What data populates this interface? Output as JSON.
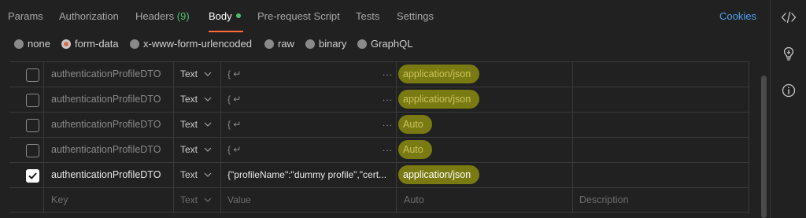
{
  "tabs": [
    {
      "label": "Params"
    },
    {
      "label": "Authorization"
    },
    {
      "label": "Headers",
      "count": "(9)"
    },
    {
      "label": "Body",
      "active": true
    },
    {
      "label": "Pre-request Script"
    },
    {
      "label": "Tests"
    },
    {
      "label": "Settings"
    }
  ],
  "cookies_label": "Cookies",
  "body_types": [
    {
      "label": "none",
      "selected": false
    },
    {
      "label": "form-data",
      "selected": true
    },
    {
      "label": "x-www-form-urlencoded",
      "selected": false
    },
    {
      "label": "raw",
      "selected": false
    },
    {
      "label": "binary",
      "selected": false
    },
    {
      "label": "GraphQL",
      "selected": false
    }
  ],
  "rows": [
    {
      "checked": false,
      "key": "authenticationProfileDTO",
      "type": "Text",
      "value": "{ ↵",
      "content_type": "application/json"
    },
    {
      "checked": false,
      "key": "authenticationProfileDTO",
      "type": "Text",
      "value": "{ ↵",
      "content_type": "application/json"
    },
    {
      "checked": false,
      "key": "authenticationProfileDTO",
      "type": "Text",
      "value": "{ ↵",
      "content_type": "Auto"
    },
    {
      "checked": false,
      "key": "authenticationProfileDTO",
      "type": "Text",
      "value": "{ ↵",
      "content_type": "Auto"
    },
    {
      "checked": true,
      "key": "authenticationProfileDTO",
      "type": "Text",
      "value": "{\"profileName\":\"dummy profile\",\"cert...",
      "content_type": "application/json"
    }
  ],
  "placeholder_row": {
    "key": "Key",
    "type": "Text",
    "value": "Value",
    "content_type": "Auto",
    "description": "Description"
  },
  "ellipsis": "...",
  "colors": {
    "accent": "#ff6c37",
    "active_dot": "#4ebf6a",
    "link": "#4d9ff0",
    "highlight": "#7a7a12"
  },
  "sidebar_icons": [
    "code-icon",
    "lightbulb-icon",
    "info-icon"
  ]
}
